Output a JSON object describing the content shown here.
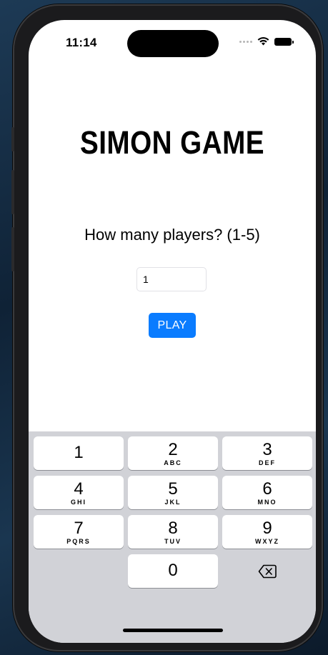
{
  "status_bar": {
    "time": "11:14",
    "icons": [
      "cellular-dots-icon",
      "wifi-icon",
      "battery-icon"
    ]
  },
  "app": {
    "title": "SIMON GAME",
    "question": "How many players? (1-5)",
    "players_input_value": "1",
    "play_label": "PLAY"
  },
  "keyboard": {
    "keys": [
      {
        "digit": "1",
        "letters": ""
      },
      {
        "digit": "2",
        "letters": "ABC"
      },
      {
        "digit": "3",
        "letters": "DEF"
      },
      {
        "digit": "4",
        "letters": "GHI"
      },
      {
        "digit": "5",
        "letters": "JKL"
      },
      {
        "digit": "6",
        "letters": "MNO"
      },
      {
        "digit": "7",
        "letters": "PQRS"
      },
      {
        "digit": "8",
        "letters": "TUV"
      },
      {
        "digit": "9",
        "letters": "WXYZ"
      },
      {
        "digit": "0",
        "letters": ""
      }
    ],
    "delete_icon": "delete-backspace-icon"
  },
  "colors": {
    "accent": "#0a7cff",
    "keyboard_bg": "#d1d2d7",
    "key_bg": "#ffffff"
  }
}
